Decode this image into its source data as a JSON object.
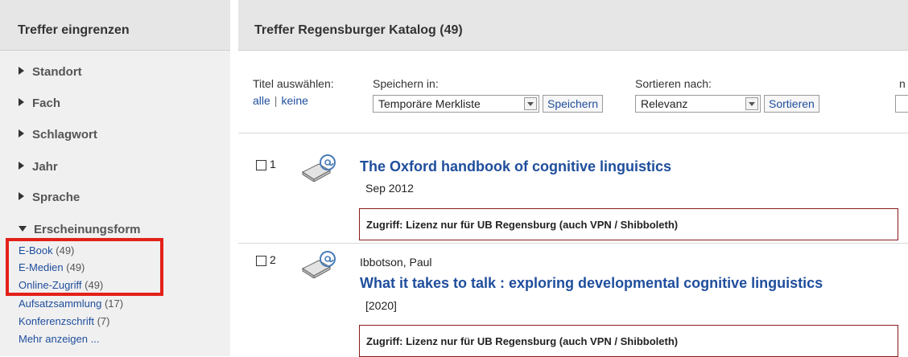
{
  "sidebar": {
    "title": "Treffer eingrenzen",
    "facets": [
      {
        "label": "Standort",
        "expanded": false
      },
      {
        "label": "Fach",
        "expanded": false
      },
      {
        "label": "Schlagwort",
        "expanded": false
      },
      {
        "label": "Jahr",
        "expanded": false
      },
      {
        "label": "Sprache",
        "expanded": false
      },
      {
        "label": "Erscheinungsform",
        "expanded": true
      }
    ],
    "subitems": [
      {
        "label": "E-Book",
        "count": "(49)"
      },
      {
        "label": "E-Medien",
        "count": "(49)"
      },
      {
        "label": "Online-Zugriff",
        "count": "(49)"
      },
      {
        "label": "Aufsatzsammlung",
        "count": "(17)"
      },
      {
        "label": "Konferenzschrift",
        "count": "(7)"
      }
    ],
    "more_label": "Mehr anzeigen ...",
    "highlight_color": "#e32119"
  },
  "main": {
    "title": "Treffer Regensburger Katalog (49)",
    "select_titles_label": "Titel auswählen:",
    "select_all": "alle",
    "select_separator": "|",
    "select_none": "keine",
    "save_in_label": "Speichern in:",
    "save_in_value": "Temporäre Merkliste",
    "save_button": "Speichern",
    "sort_by_label": "Sortieren nach:",
    "sort_value": "Relevanz",
    "sort_button": "Sortieren",
    "cut_label": "n",
    "results": [
      {
        "number": "1",
        "author": "",
        "title": "The Oxford handbook of cognitive linguistics",
        "date": "Sep 2012",
        "access": "Zugriff: Lizenz nur für UB Regensburg (auch VPN / Shibboleth)"
      },
      {
        "number": "2",
        "author": "Ibbotson, Paul",
        "title": "What it takes to talk : exploring developmental cognitive linguistics",
        "date": "[2020]",
        "access": "Zugriff: Lizenz nur für UB Regensburg (auch VPN / Shibboleth)"
      }
    ],
    "link_color": "#1f4e9c"
  }
}
